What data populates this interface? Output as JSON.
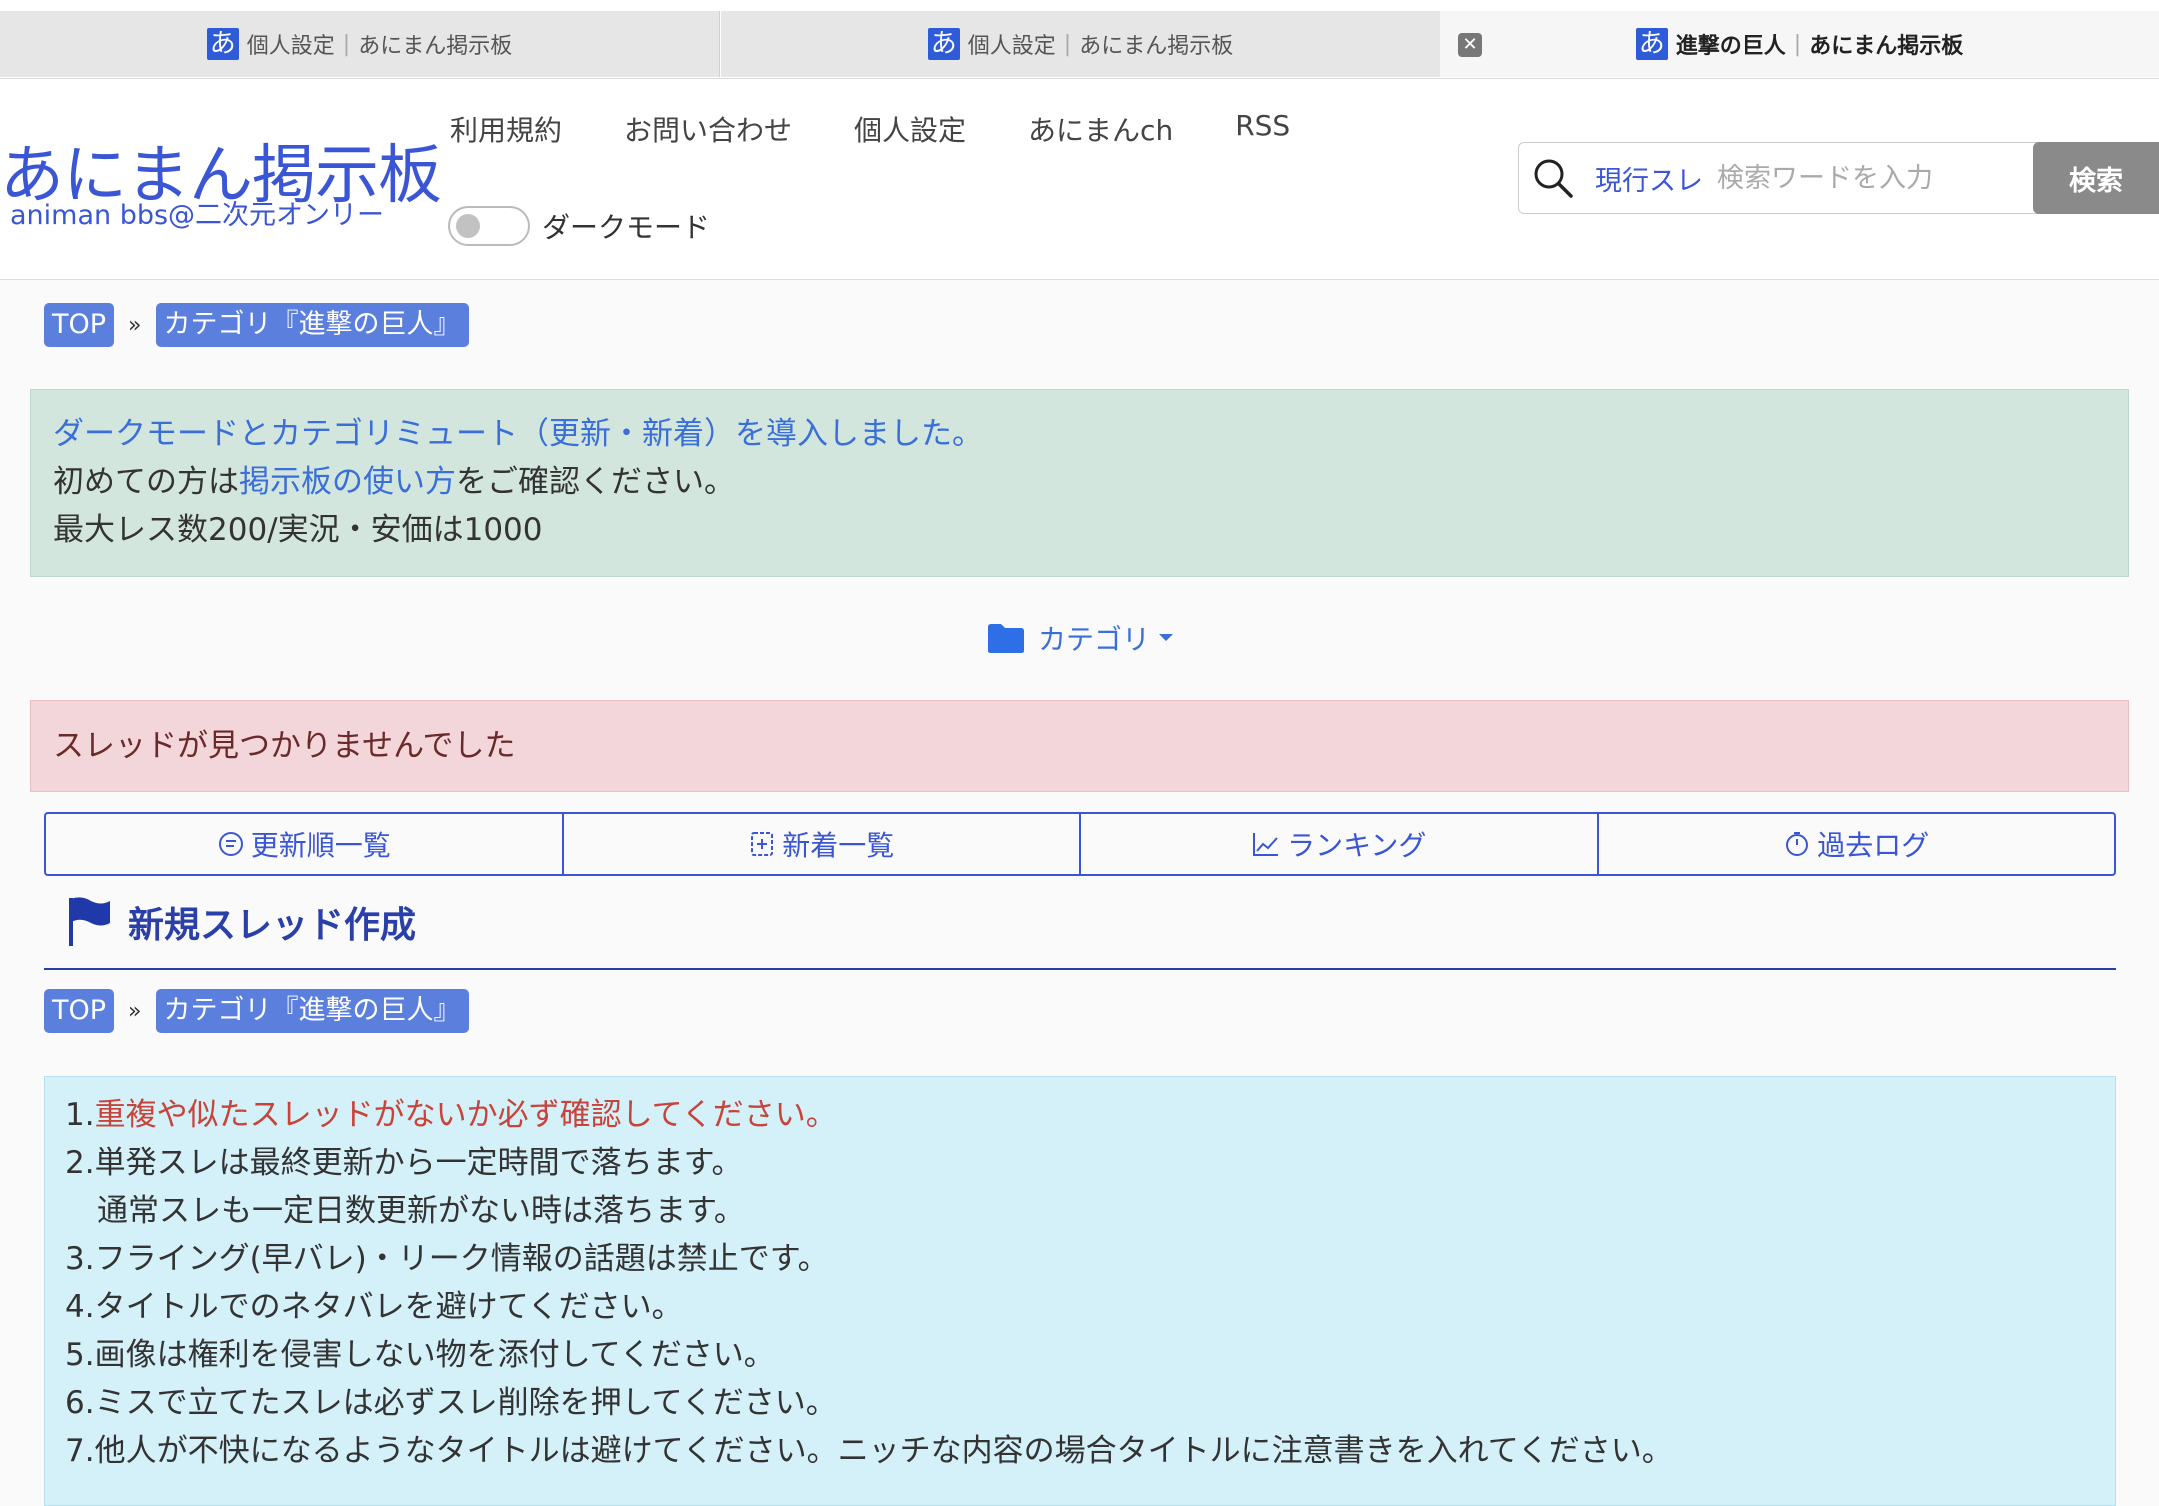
{
  "tabs": [
    {
      "favicon": "あ",
      "title": "個人設定",
      "site": "あにまん掲示板",
      "active": false
    },
    {
      "favicon": "あ",
      "title": "個人設定",
      "site": "あにまん掲示板",
      "active": false
    },
    {
      "favicon": "あ",
      "title": "進撃の巨人",
      "site": "あにまん掲示板",
      "active": true
    }
  ],
  "tab_close_glyph": "✕",
  "header": {
    "logo_main": "あにまん掲示板",
    "logo_sub": "animan bbs@二次元オンリー",
    "nav": [
      "利用規約",
      "お問い合わせ",
      "個人設定",
      "あにまんch",
      "RSS"
    ],
    "dark_mode_label": "ダークモード",
    "dark_mode_on": false,
    "search": {
      "scope": "現行スレ",
      "placeholder": "検索ワードを入力",
      "button": "検索"
    }
  },
  "breadcrumb": {
    "top": "TOP",
    "sep": "»",
    "category": "カテゴリ『進撃の巨人』"
  },
  "notice": {
    "line1": "ダークモードとカテゴリミュート（更新・新着）を導入しました。",
    "line2_prefix": "初めての方は",
    "line2_link": "掲示板の使い方",
    "line2_suffix": "をご確認ください。",
    "line3": "最大レス数200/実況・安価は1000"
  },
  "category_dropdown": "カテゴリ",
  "alert": "スレッドが見つかりませんでした",
  "list_nav": [
    "更新順一覧",
    "新着一覧",
    "ランキング",
    "過去ログ"
  ],
  "section_title": "新規スレッド作成",
  "rules": {
    "r1_num": "1.",
    "r1_text": "重複や似たスレッドがないか必ず確認してください。",
    "r2": "2.単発スレは最終更新から一定時間で落ちます。",
    "r2b": "通常スレも一定日数更新がない時は落ちます。",
    "r3": "3.フライング(早バレ)・リーク情報の話題は禁止です。",
    "r4": "4.タイトルでのネタバレを避けてください。",
    "r5": "5.画像は権利を侵害しない物を添付してください。",
    "r6": "6.ミスで立てたスレは必ずスレ削除を押してください。",
    "r7": "7.他人が不快になるようなタイトルは避けてください。ニッチな内容の場合タイトルに注意書きを入れてください。"
  },
  "colors": {
    "brand": "#3a56d4",
    "notice_bg": "#d3e6de",
    "alert_bg": "#f2d6d9",
    "rules_bg": "#d4f0f8",
    "rule_highlight": "#c8443b"
  }
}
